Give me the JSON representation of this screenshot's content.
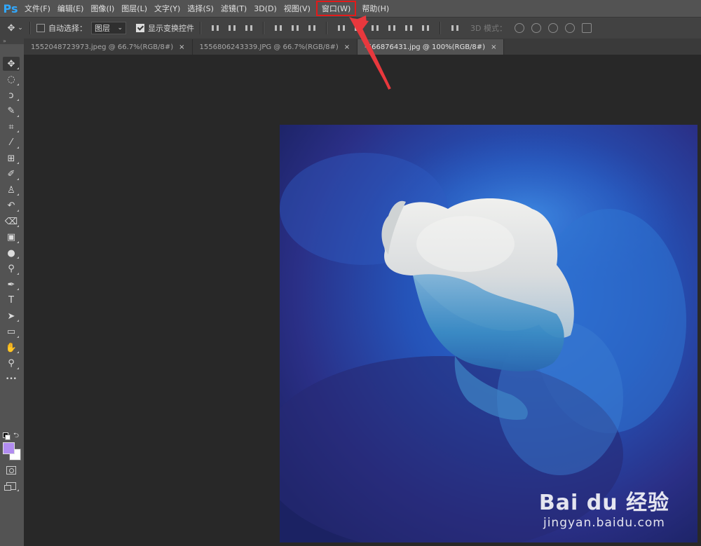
{
  "app": {
    "logo": "Ps"
  },
  "menus": [
    {
      "label": "文件(F)"
    },
    {
      "label": "编辑(E)"
    },
    {
      "label": "图像(I)"
    },
    {
      "label": "图层(L)"
    },
    {
      "label": "文字(Y)"
    },
    {
      "label": "选择(S)"
    },
    {
      "label": "滤镜(T)"
    },
    {
      "label": "3D(D)"
    },
    {
      "label": "视图(V)"
    },
    {
      "label": "窗口(W)",
      "highlighted": true
    },
    {
      "label": "帮助(H)"
    }
  ],
  "options_bar": {
    "move_icon": "move-tool-icon",
    "auto_select_label": "自动选择：",
    "auto_select_checked": false,
    "layer_select_value": "图层",
    "show_transform_label": "显示变换控件",
    "show_transform_checked": true,
    "mode_3d_label": "3D 模式："
  },
  "tabs": [
    {
      "label": "1552048723973.jpeg @ 66.7%(RGB/8#)",
      "active": false
    },
    {
      "label": "1556806243339.JPG @ 66.7%(RGB/8#)",
      "active": false
    },
    {
      "label": "-666876431.jpg @ 100%(RGB/8#)",
      "active": true
    }
  ],
  "tab_close_glyph": "×",
  "tools": [
    {
      "name": "move-tool-icon",
      "glyph": "✥"
    },
    {
      "name": "marquee-tool-icon",
      "glyph": "◌"
    },
    {
      "name": "lasso-tool-icon",
      "glyph": "ↄ"
    },
    {
      "name": "quick-select-tool-icon",
      "glyph": "✎"
    },
    {
      "name": "crop-tool-icon",
      "glyph": "⌗"
    },
    {
      "name": "eyedropper-tool-icon",
      "glyph": "⁄"
    },
    {
      "name": "healing-brush-tool-icon",
      "glyph": "⊞"
    },
    {
      "name": "brush-tool-icon",
      "glyph": "✐"
    },
    {
      "name": "clone-stamp-tool-icon",
      "glyph": "♙"
    },
    {
      "name": "history-brush-tool-icon",
      "glyph": "↶"
    },
    {
      "name": "eraser-tool-icon",
      "glyph": "⌫"
    },
    {
      "name": "gradient-tool-icon",
      "glyph": "▣"
    },
    {
      "name": "blur-tool-icon",
      "glyph": "●"
    },
    {
      "name": "dodge-tool-icon",
      "glyph": "⚲"
    },
    {
      "name": "pen-tool-icon",
      "glyph": "✒"
    },
    {
      "name": "type-tool-icon",
      "glyph": "T"
    },
    {
      "name": "path-select-tool-icon",
      "glyph": "➤"
    },
    {
      "name": "rectangle-tool-icon",
      "glyph": "▭"
    },
    {
      "name": "hand-tool-icon",
      "glyph": "✋"
    },
    {
      "name": "zoom-tool-icon",
      "glyph": "⚲"
    },
    {
      "name": "edit-toolbar-icon",
      "glyph": "•••"
    }
  ],
  "colors": {
    "foreground": "#b18cf0",
    "background": "#ffffff",
    "highlight": "#e31a1a",
    "arrow": "#e8383d"
  },
  "watermark": {
    "logo": "Bai du 经验",
    "url": "jingyan.baidu.com"
  }
}
